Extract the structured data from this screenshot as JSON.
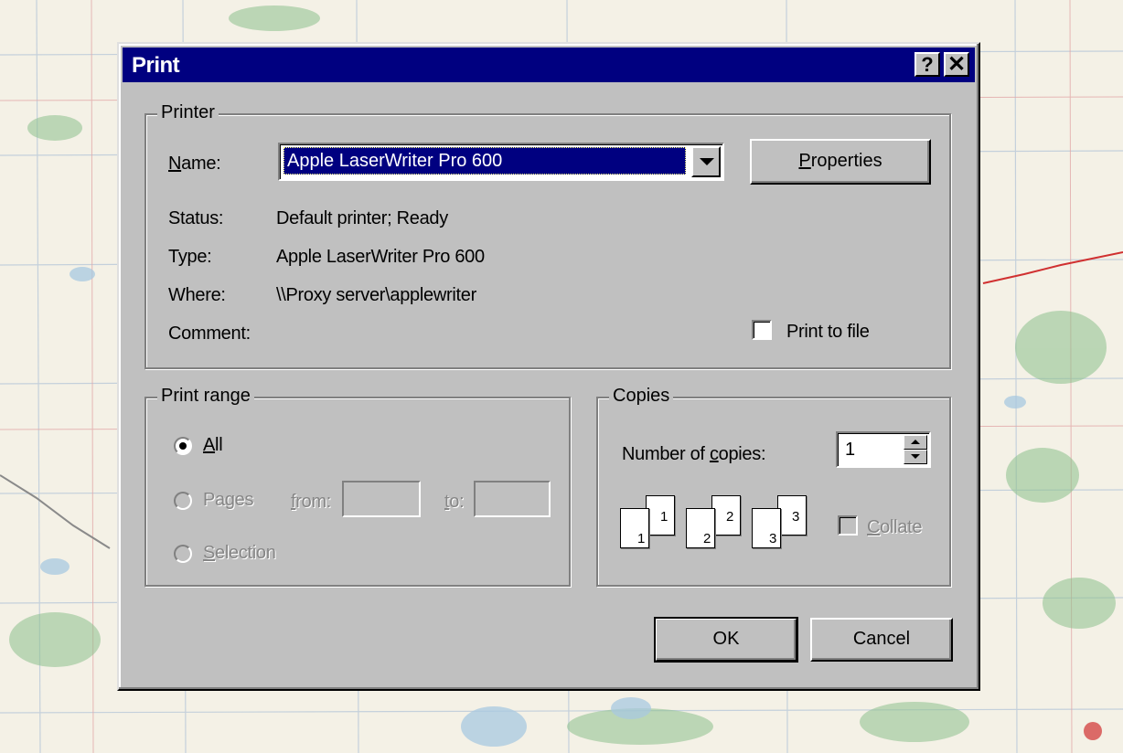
{
  "dialog": {
    "title": "Print",
    "help_button": "?",
    "close_button": "✕"
  },
  "printer": {
    "group_label": "Printer",
    "name_label_u": "N",
    "name_label_rest": "ame:",
    "name_value": "Apple LaserWriter Pro 600",
    "properties_u": "P",
    "properties_rest": "roperties",
    "status_label": "Status:",
    "status_value": "Default printer; Ready",
    "type_label": "Type:",
    "type_value": "Apple LaserWriter Pro 600",
    "where_label": "Where:",
    "where_value": "\\\\Proxy server\\applewriter",
    "comment_label": "Comment:",
    "print_to_file_label": "Print to file",
    "print_to_file_checked": false
  },
  "print_range": {
    "group_label": "Print range",
    "all_u": "A",
    "all_rest": "ll",
    "pages_label": "Pages",
    "from_u": "f",
    "from_rest": "rom:",
    "to_u": "t",
    "to_rest": "o:",
    "selection_u": "S",
    "selection_rest": "election",
    "selected": "All"
  },
  "copies": {
    "group_label": "Copies",
    "number_label_pre": "Number of ",
    "number_label_u": "c",
    "number_label_rest": "opies:",
    "number_value": "1",
    "collate_u": "C",
    "collate_rest": "ollate",
    "collate_checked": false,
    "page_icons": [
      "1",
      "1",
      "2",
      "2",
      "3",
      "3"
    ]
  },
  "buttons": {
    "ok": "OK",
    "cancel": "Cancel"
  },
  "colors": {
    "titlebar": "#000080",
    "dialog_face": "#c0c0c0",
    "selection": "#000080"
  }
}
